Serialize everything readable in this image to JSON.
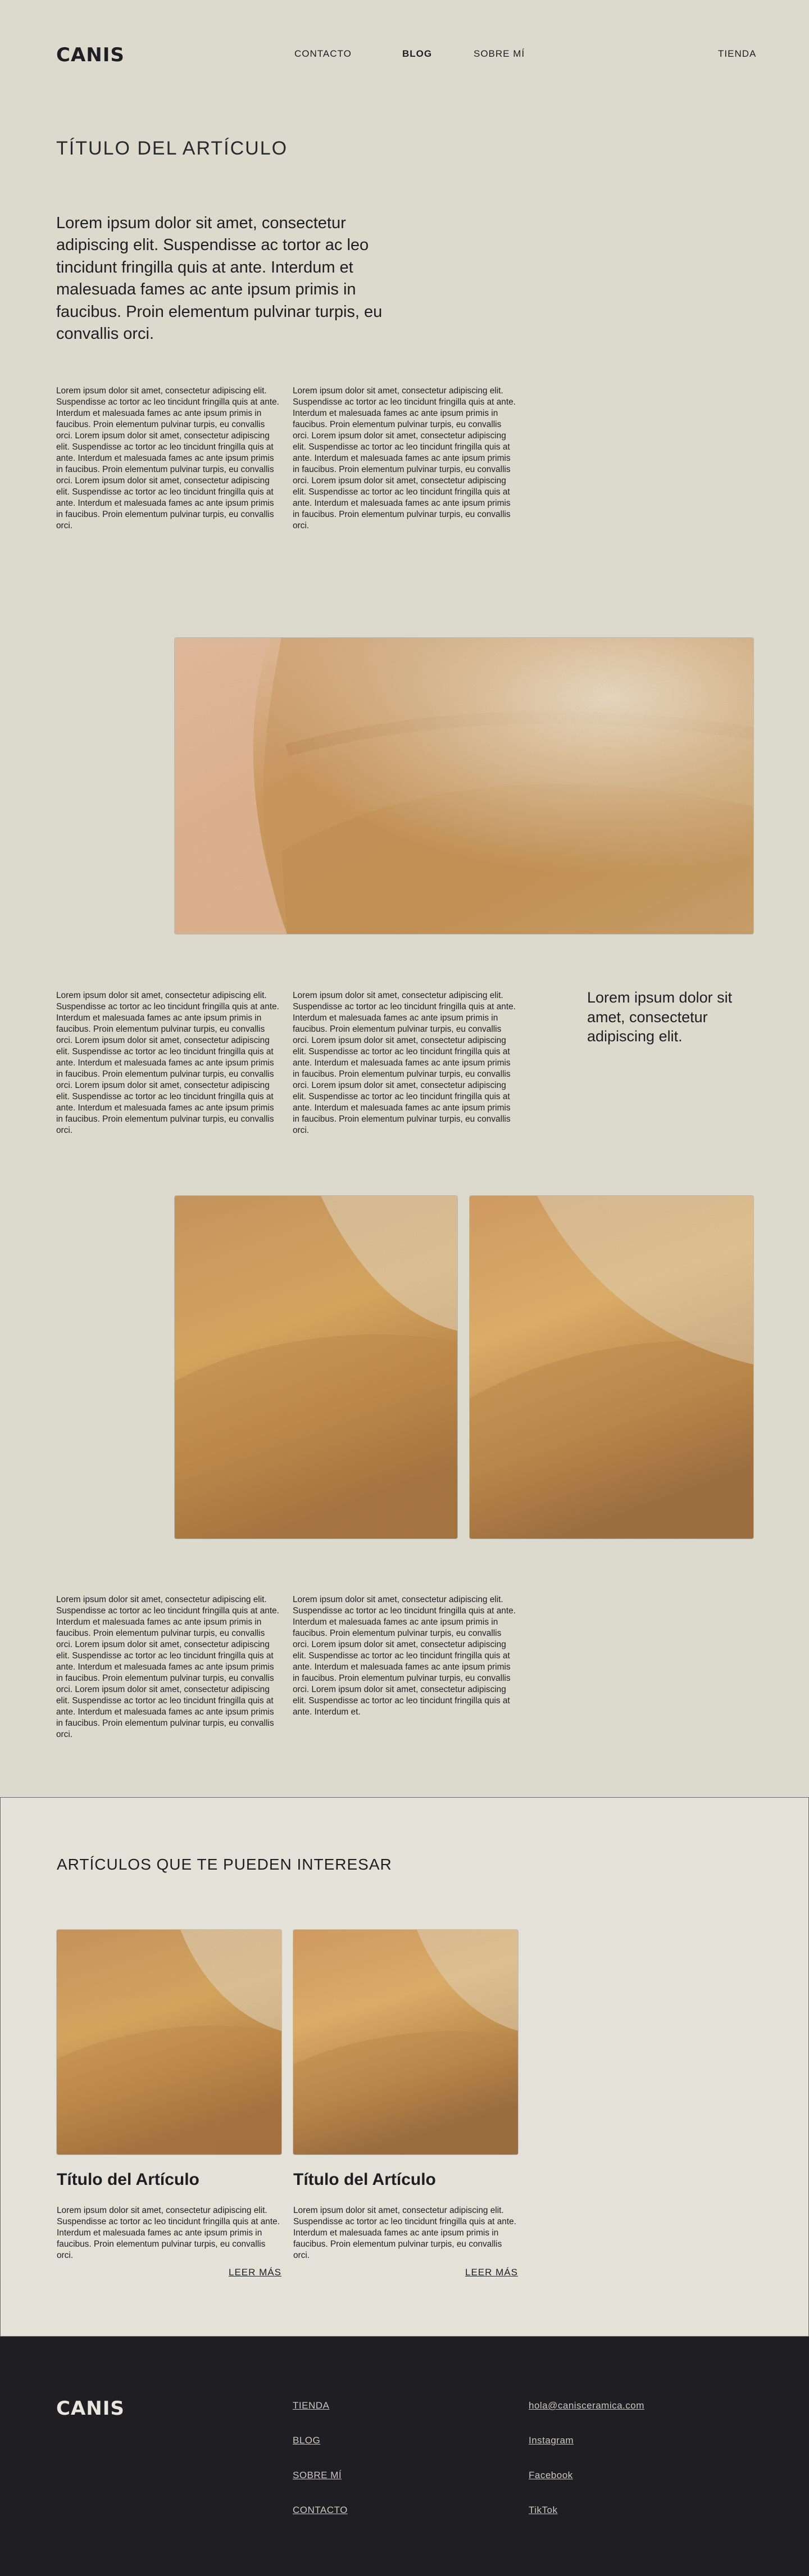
{
  "header": {
    "logo": "CANIS",
    "nav": [
      "CONTACTO",
      "BLOG",
      "SOBRE MÍ"
    ],
    "shop": "TIENDA"
  },
  "article": {
    "title": "TÍTULO DEL ARTÍCULO",
    "lead": "Lorem ipsum dolor sit amet, consectetur adipiscing elit. Suspendisse ac tortor ac leo tincidunt fringilla quis at ante. Interdum et malesuada fames ac ante ipsum primis in faucibus. Proin elementum pulvinar turpis, eu convallis orci.",
    "block1_col1": "Lorem ipsum dolor sit amet, consectetur adipiscing elit. Suspendisse ac tortor ac leo tincidunt fringilla quis at ante. Interdum et malesuada fames ac ante ipsum primis in faucibus. Proin elementum pulvinar turpis, eu convallis orci. Lorem ipsum dolor sit amet, consectetur adipiscing elit. Suspendisse ac tortor ac leo tincidunt fringilla quis at ante. Interdum et malesuada fames ac ante ipsum primis in faucibus. Proin elementum pulvinar turpis, eu convallis orci. Lorem ipsum dolor sit amet, consectetur adipiscing elit. Suspendisse ac tortor ac leo tincidunt fringilla quis at ante. Interdum et malesuada fames ac ante ipsum primis in faucibus. Proin elementum pulvinar turpis, eu convallis orci.",
    "block1_col2": "Lorem ipsum dolor sit amet, consectetur adipiscing elit. Suspendisse ac tortor ac leo tincidunt fringilla quis at ante. Interdum et malesuada fames ac ante ipsum primis in faucibus. Proin elementum pulvinar turpis, eu convallis orci. Lorem ipsum dolor sit amet, consectetur adipiscing elit. Suspendisse ac tortor ac leo tincidunt fringilla quis at ante. Interdum et malesuada fames ac ante ipsum primis in faucibus. Proin elementum pulvinar turpis, eu convallis orci. Lorem ipsum dolor sit amet, consectetur adipiscing elit. Suspendisse ac tortor ac leo tincidunt fringilla quis at ante. Interdum et malesuada fames ac ante ipsum primis in faucibus. Proin elementum pulvinar turpis, eu convallis orci.",
    "block2_col1": "Lorem ipsum dolor sit amet, consectetur adipiscing elit. Suspendisse ac tortor ac leo tincidunt fringilla quis at ante. Interdum et malesuada fames ac ante ipsum primis in faucibus. Proin elementum pulvinar turpis, eu convallis orci. Lorem ipsum dolor sit amet, consectetur adipiscing elit. Suspendisse ac tortor ac leo tincidunt fringilla quis at ante. Interdum et malesuada fames ac ante ipsum primis in faucibus. Proin elementum pulvinar turpis, eu convallis orci. Lorem ipsum dolor sit amet, consectetur adipiscing elit. Suspendisse ac tortor ac leo tincidunt fringilla quis at ante. Interdum et malesuada fames ac ante ipsum primis in faucibus. Proin elementum pulvinar turpis, eu convallis orci.",
    "block2_col2": "Lorem ipsum dolor sit amet, consectetur adipiscing elit. Suspendisse ac tortor ac leo tincidunt fringilla quis at ante. Interdum et malesuada fames ac ante ipsum primis in faucibus. Proin elementum pulvinar turpis, eu convallis orci. Lorem ipsum dolor sit amet, consectetur adipiscing elit. Suspendisse ac tortor ac leo tincidunt fringilla quis at ante. Interdum et malesuada fames ac ante ipsum primis in faucibus. Proin elementum pulvinar turpis, eu convallis orci. Lorem ipsum dolor sit amet, consectetur adipiscing elit. Suspendisse ac tortor ac leo tincidunt fringilla quis at ante. Interdum et malesuada fames ac ante ipsum primis in faucibus. Proin elementum pulvinar turpis, eu convallis orci.",
    "pull_quote": "Lorem ipsum dolor sit amet, consectetur adipiscing elit.",
    "block3_col1": "Lorem ipsum dolor sit amet, consectetur adipiscing elit. Suspendisse ac tortor ac leo tincidunt fringilla quis at ante. Interdum et malesuada fames ac ante ipsum primis in faucibus. Proin elementum pulvinar turpis, eu convallis orci. Lorem ipsum dolor sit amet, consectetur adipiscing elit. Suspendisse ac tortor ac leo tincidunt fringilla quis at ante. Interdum et malesuada fames ac ante ipsum primis in faucibus. Proin elementum pulvinar turpis, eu convallis orci. Lorem ipsum dolor sit amet, consectetur adipiscing elit. Suspendisse ac tortor ac leo tincidunt fringilla quis at ante. Interdum et malesuada fames ac ante ipsum primis in faucibus. Proin elementum pulvinar turpis, eu convallis orci.",
    "block3_col2": "Lorem ipsum dolor sit amet, consectetur adipiscing elit. Suspendisse ac tortor ac leo tincidunt fringilla quis at ante. Interdum et malesuada fames ac ante ipsum primis in faucibus. Proin elementum pulvinar turpis, eu convallis orci. Lorem ipsum dolor sit amet, consectetur adipiscing elit. Suspendisse ac tortor ac leo tincidunt fringilla quis at ante. Interdum et malesuada fames ac ante ipsum primis in faucibus. Proin elementum pulvinar turpis, eu convallis orci. Lorem ipsum dolor sit amet, consectetur adipiscing elit. Suspendisse ac tortor ac leo tincidunt fringilla quis at ante. Interdum et."
  },
  "related": {
    "heading": "ARTÍCULOS QUE TE PUEDEN INTERESAR",
    "cards": [
      {
        "title": "Título del Artículo",
        "excerpt": "Lorem ipsum dolor sit amet, consectetur adipiscing elit. Suspendisse ac tortor ac leo tincidunt fringilla quis at ante. Interdum et malesuada fames ac ante ipsum primis in faucibus. Proin elementum pulvinar turpis, eu convallis orci.",
        "cta": "LEER MÁS"
      },
      {
        "title": "Título del Artículo",
        "excerpt": "Lorem ipsum dolor sit amet, consectetur adipiscing elit. Suspendisse ac tortor ac leo tincidunt fringilla quis at ante. Interdum et malesuada fames ac ante ipsum primis in faucibus. Proin elementum pulvinar turpis, eu convallis orci.",
        "cta": "LEER MÁS"
      }
    ]
  },
  "footer": {
    "logo": "CANIS",
    "links": [
      "TIENDA",
      "BLOG",
      "SOBRE MÍ",
      "CONTACTO"
    ],
    "contact": [
      "hola@canisceramica.com",
      "Instagram",
      "Facebook",
      "TikTok"
    ]
  },
  "colors": {
    "background": "#dcd9cd",
    "related_background": "#e4e1d8",
    "footer_background": "#1f1e22",
    "text": "#1f1e22"
  }
}
